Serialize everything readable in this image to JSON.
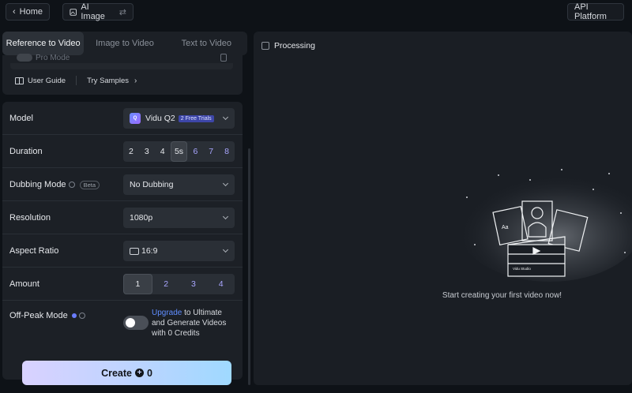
{
  "topbar": {
    "home_label": "Home",
    "ai_image_label": "AI Image",
    "api_label": "API Platform"
  },
  "tabs": [
    {
      "label": "Reference to Video"
    },
    {
      "label": "Image to Video"
    },
    {
      "label": "Text to Video"
    }
  ],
  "card1": {
    "pro_mode": "Pro Mode",
    "user_guide": "User Guide",
    "try_samples": "Try Samples"
  },
  "settings": {
    "model": {
      "label": "Model",
      "value": "Vidu Q2",
      "badge": "2 Free Trials"
    },
    "duration": {
      "label": "Duration",
      "options": [
        "2",
        "3",
        "4",
        "5s",
        "6",
        "7",
        "8"
      ],
      "selected": "5s"
    },
    "dubbing": {
      "label": "Dubbing Mode",
      "badge": "Beta",
      "value": "No Dubbing"
    },
    "resolution": {
      "label": "Resolution",
      "value": "1080p"
    },
    "aspect": {
      "label": "Aspect Ratio",
      "value": "16:9"
    },
    "amount": {
      "label": "Amount",
      "options": [
        "1",
        "2",
        "3",
        "4"
      ],
      "selected": "1"
    },
    "offpeak": {
      "label": "Off-Peak Mode",
      "upgrade": "Upgrade",
      "text": " to Ultimate and Generate Videos with 0 Credits"
    }
  },
  "create": {
    "label": "Create",
    "credits": "0"
  },
  "right": {
    "processing": "Processing",
    "cta": "Start creating your first video now!",
    "illustration_text": [
      "Aa",
      "Vidu Studio"
    ]
  },
  "colors": {
    "accent_blue": "#5f8dff",
    "option_purple": "#a9a6ff",
    "panel": "#1c2026"
  }
}
